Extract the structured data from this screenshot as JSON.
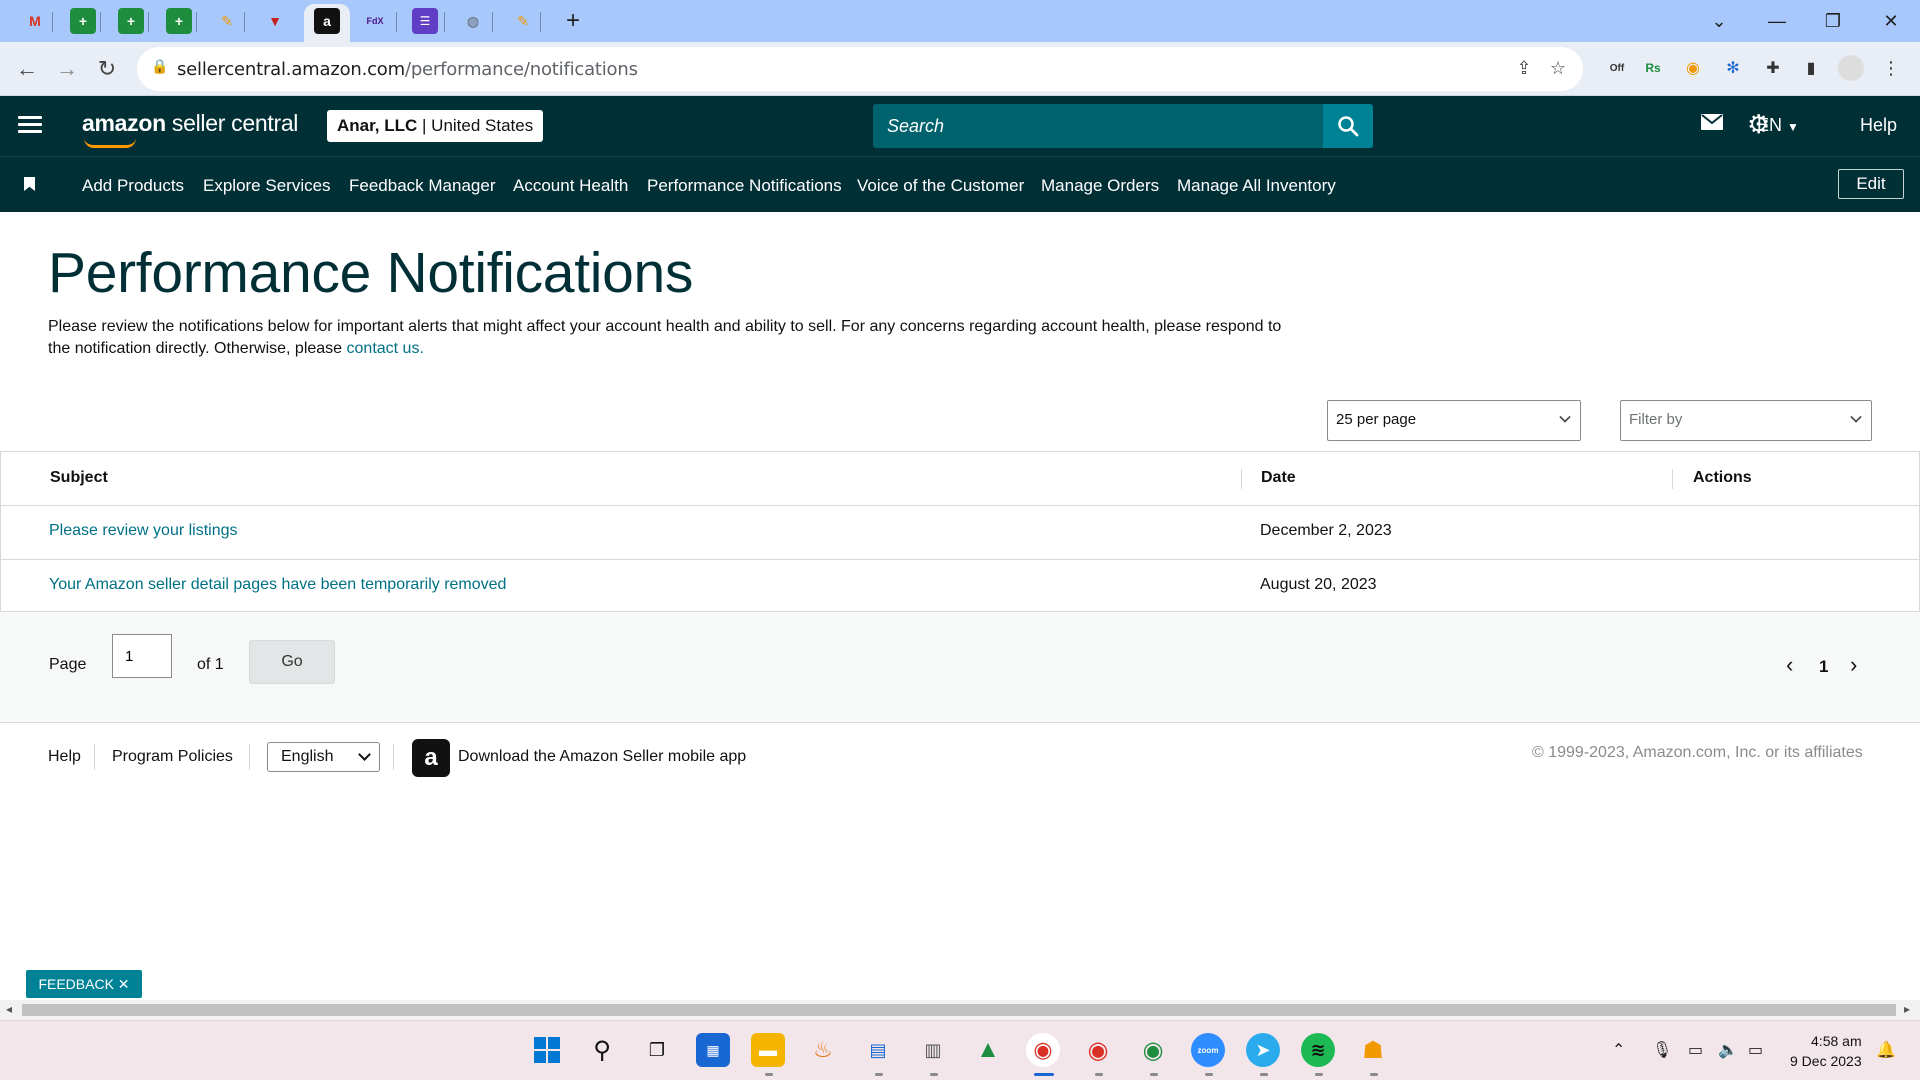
{
  "browser": {
    "url_host": "sellercentral.amazon.com",
    "url_path": "/performance/notifications",
    "active_tab_icon": "amazon-a-icon"
  },
  "header": {
    "logo_bold": "amazon",
    "logo_rest": " seller central",
    "account_name": "Anar, LLC",
    "account_sep": " | ",
    "account_region": "United States",
    "search_placeholder": "Search",
    "language": "EN",
    "help": "Help"
  },
  "nav": {
    "items": [
      {
        "label": "Add Products"
      },
      {
        "label": "Explore Services"
      },
      {
        "label": "Feedback Manager"
      },
      {
        "label": "Account Health"
      },
      {
        "label": "Performance Notifications"
      },
      {
        "label": "Voice of the Customer"
      },
      {
        "label": "Manage Orders"
      },
      {
        "label": "Manage All Inventory"
      }
    ],
    "edit_label": "Edit"
  },
  "main": {
    "title": "Performance Notifications",
    "intro_text": "Please review the notifications below for important alerts that might affect your account health and ability to sell. For any concerns regarding account health, please respond to the notification directly. Otherwise, please ",
    "intro_link": "contact us.",
    "per_page": "25 per page",
    "filter_placeholder": "Filter by"
  },
  "table": {
    "columns": [
      "Subject",
      "Date",
      "Actions"
    ],
    "rows": [
      {
        "subject": "Please review your listings",
        "date": "December 2, 2023"
      },
      {
        "subject": "Your Amazon seller detail pages have been temporarily removed",
        "date": "August 20, 2023"
      }
    ]
  },
  "pager": {
    "page_label": "Page",
    "page_value": "1",
    "of_label": "of 1",
    "go_label": "Go",
    "current": "1"
  },
  "footer": {
    "help": "Help",
    "policies": "Program Policies",
    "language": "English",
    "app_text": "Download the Amazon Seller mobile app",
    "copyright": "© 1999-2023, Amazon.com, Inc. or its affiliates"
  },
  "feedback_label": "FEEDBACK ✕",
  "taskbar": {
    "time": "4:58 am",
    "date": "9 Dec 2023"
  },
  "colors": {
    "header_bg": "#002f36",
    "link": "#007185",
    "accent": "#008296"
  }
}
